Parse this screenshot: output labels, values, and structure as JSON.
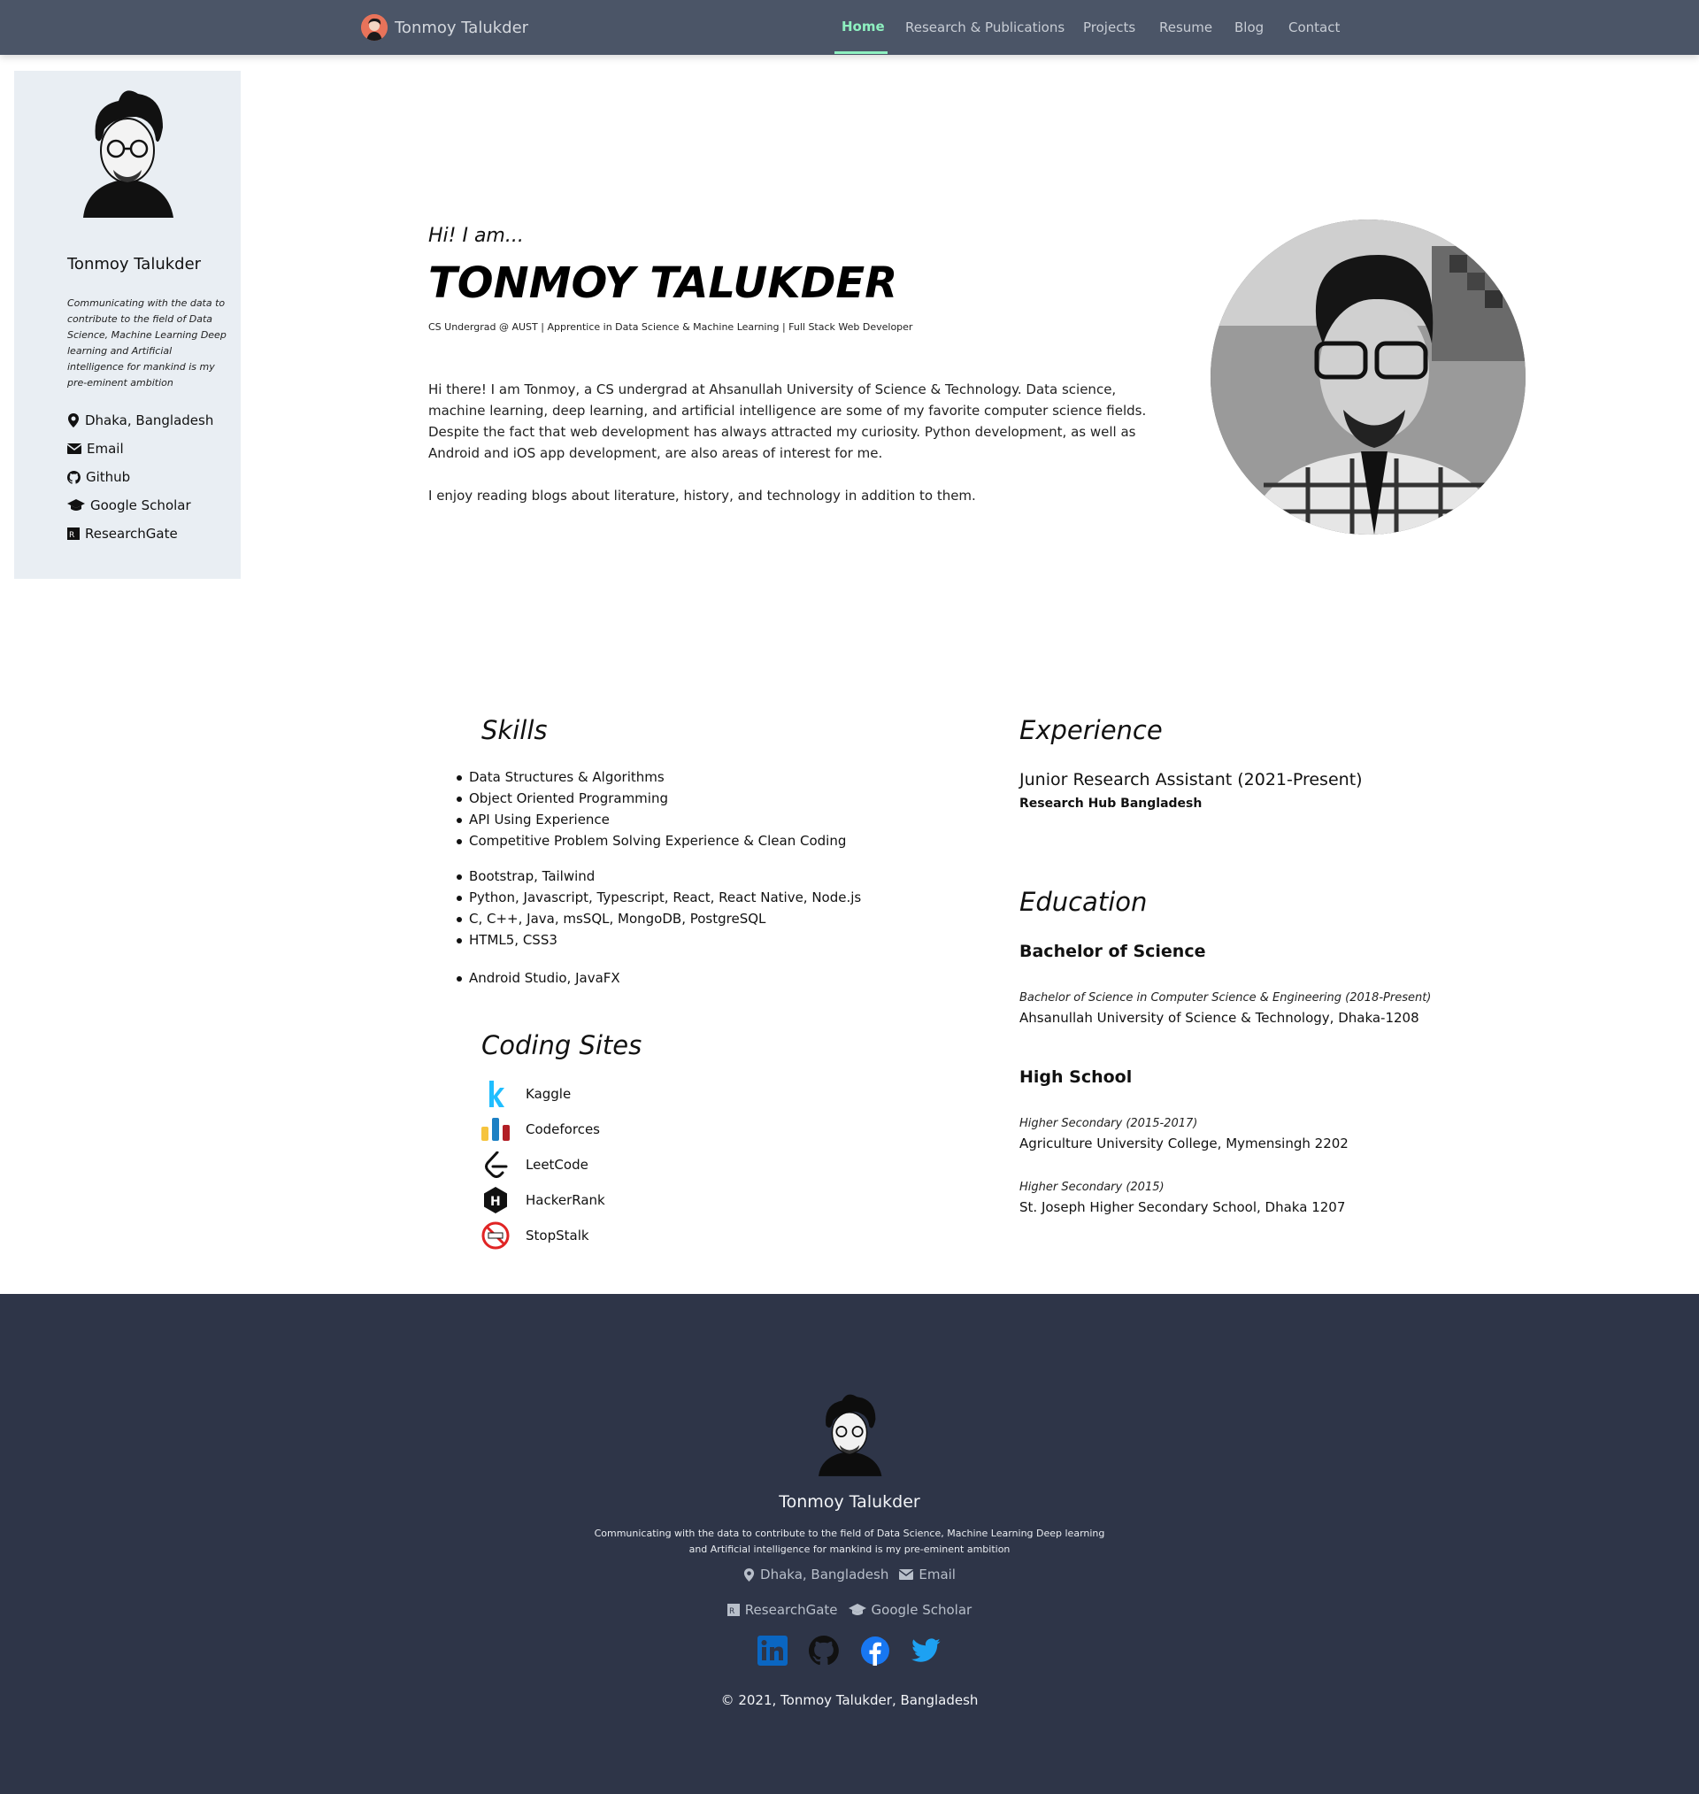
{
  "nav": {
    "brand": "Tonmoy Talukder",
    "items": [
      "Home",
      "Research & Publications",
      "Projects",
      "Resume",
      "Blog",
      "Contact"
    ],
    "active": "Home"
  },
  "sidebar": {
    "name": "Tonmoy Talukder",
    "tagline": "Communicating with the data to contribute to the field of Data Science, Machine Learning Deep learning and Artificial intelligence for mankind is my pre-eminent ambition",
    "links": [
      {
        "label": "Dhaka, Bangladesh",
        "icon": "location-pin-icon"
      },
      {
        "label": "Email",
        "icon": "envelope-icon"
      },
      {
        "label": "Github",
        "icon": "github-icon"
      },
      {
        "label": "Google Scholar",
        "icon": "graduation-cap-icon"
      },
      {
        "label": "ResearchGate",
        "icon": "researchgate-icon"
      }
    ]
  },
  "hero": {
    "greeting": "Hi! I am...",
    "name": "TONMOY TALUKDER",
    "subtitle": "CS Undergrad @ AUST | Apprentice in Data Science & Machine Learning | Full Stack Web Developer",
    "bio1": "Hi there! I am Tonmoy, a CS undergrad at Ahsanullah University of Science & Technology. Data science, machine learning, deep learning, and artificial intelligence are some of my favorite computer science fields. Despite the fact that web development has always attracted my curiosity. Python development, as well as Android and iOS app development, are also areas of interest for me.",
    "bio2": "I enjoy reading blogs about literature, history, and technology in addition to them."
  },
  "skills": {
    "title": "Skills",
    "groups": [
      [
        "Data Structures & Algorithms",
        "Object Oriented Programming",
        "API Using Experience",
        "Competitive Problem Solving Experience & Clean Coding"
      ],
      [
        "Bootstrap, Tailwind",
        "Python, Javascript, Typescript, React, React Native, Node.js",
        "C, C++, Java, msSQL, MongoDB, PostgreSQL",
        "HTML5, CSS3"
      ],
      [
        "Android Studio, JavaFX"
      ]
    ]
  },
  "coding_sites": {
    "title": "Coding Sites",
    "sites": [
      {
        "label": "Kaggle",
        "icon": "kaggle-icon"
      },
      {
        "label": "Codeforces",
        "icon": "codeforces-icon"
      },
      {
        "label": "LeetCode",
        "icon": "leetcode-icon"
      },
      {
        "label": "HackerRank",
        "icon": "hackerrank-icon"
      },
      {
        "label": "StopStalk",
        "icon": "stopstalk-icon"
      }
    ]
  },
  "experience": {
    "title": "Experience",
    "job_title": "Junior Research Assistant (2021-Present)",
    "org": "Research Hub Bangladesh"
  },
  "education": {
    "title": "Education",
    "bachelor_head": "Bachelor of Science",
    "bachelor_degree": "Bachelor of Science in Computer Science & Engineering (2018-Present)",
    "bachelor_inst": "Ahsanullah University of Science & Technology, Dhaka-1208",
    "school_head": "High School",
    "hsc_degree": "Higher Secondary (2015-2017)",
    "hsc_inst": "Agriculture University College, Mymensingh 2202",
    "ssc_degree": "Higher Secondary (2015)",
    "ssc_inst": "St. Joseph Higher Secondary School, Dhaka 1207"
  },
  "footer": {
    "name": "Tonmoy Talukder",
    "tagline": "Communicating with the data to contribute to the field of Data Science, Machine Learning Deep learning and Artificial intelligence for mankind is my pre-eminent ambition",
    "location": "Dhaka, Bangladesh",
    "email": "Email",
    "researchgate": "ResearchGate",
    "scholar": "Google Scholar",
    "social": [
      "linkedin-icon",
      "github-icon",
      "facebook-icon",
      "twitter-icon"
    ],
    "copyright": "© 2021, Tonmoy Talukder, Bangladesh"
  },
  "colors": {
    "nav_bg": "#4b5567",
    "nav_active": "#8ef0c0",
    "sidebar_bg": "#e9eef3",
    "footer_bg": "#2e3548"
  }
}
